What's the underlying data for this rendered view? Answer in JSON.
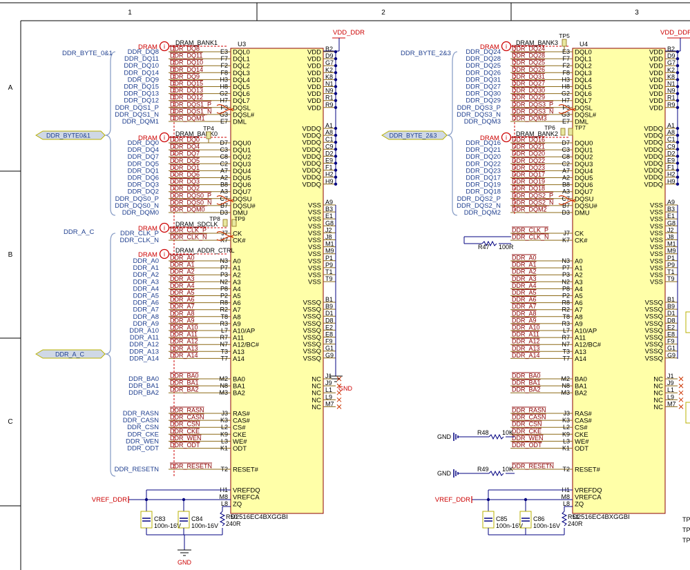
{
  "frame": {
    "columns": [
      "1",
      "2",
      "3"
    ],
    "rows": [
      "A",
      "B",
      "C"
    ]
  },
  "colors": {
    "wire": "#000080",
    "label": "#1f3f8f",
    "netlabel": "#8b0000",
    "body": "#ffffa8",
    "border": "#8b0000",
    "drawing": "#8b6914",
    "dram": "#cc0000",
    "tp": "#e8e8a0",
    "frame": "#000000"
  },
  "u3": {
    "ref": "U3",
    "part": "D2516EC4BXGGBI",
    "power_net": "VDD_DDR",
    "ground_net": "GND",
    "vref_net": "VREF_DDR",
    "groups": [
      {
        "dram": "DRAM",
        "bank": "DRAM_BANK1",
        "bus": "DDR_BYTE_0&1",
        "bus_label_text": "DDR_BYTE_0&1"
      },
      {
        "dram": "DRAM",
        "bank": "DRAM_BANK0"
      },
      {
        "dram": "DRAM",
        "bank": "DRAM_SDCLK",
        "bus": "DDR_A_C"
      },
      {
        "dram": "DRAM",
        "bank": "DRAM_ADDR_CTRL"
      }
    ],
    "bus_port_upper": "DDR_BYTE0&1",
    "bus_port_lower": "DDR_A_C",
    "testpoints": [
      "TP4",
      "TP8",
      "TP9"
    ],
    "caps": [
      {
        "ref": "C83",
        "val": "100n-16V"
      },
      {
        "ref": "C84",
        "val": "100n-16V"
      }
    ],
    "resistor": {
      "ref": "R50",
      "val": "240R"
    },
    "left_pins": [
      {
        "ext": "DDR_DQ8",
        "net": "DDR_DQ8",
        "num": "E3",
        "name": "DQL0"
      },
      {
        "ext": "DDR_DQ11",
        "net": "DDR_DQ11",
        "num": "F7",
        "name": "DQL1"
      },
      {
        "ext": "DDR_DQ10",
        "net": "DDR_DQ10",
        "num": "F2",
        "name": "DQL2"
      },
      {
        "ext": "DDR_DQ14",
        "net": "DDR_DQ14",
        "num": "F8",
        "name": "DQL3"
      },
      {
        "ext": "DDR_DQ9",
        "net": "DDR_DQ9",
        "num": "H3",
        "name": "DQL4"
      },
      {
        "ext": "DDR_DQ15",
        "net": "DDR_DQ15",
        "num": "H8",
        "name": "DQL5"
      },
      {
        "ext": "DDR_DQ13",
        "net": "DDR_DQ13",
        "num": "G2",
        "name": "DQL6"
      },
      {
        "ext": "DDR_DQ12",
        "net": "DDR_DQ12",
        "num": "H7",
        "name": "DQL7"
      },
      {
        "ext": "DDR_DQS1_P",
        "net": "DDR_DQS1_P",
        "num": "F3",
        "name": "DQSL"
      },
      {
        "ext": "DDR_DQS1_N",
        "net": "DDR_DQS1_N",
        "num": "G3",
        "name": "DQSL#"
      },
      {
        "ext": "DDR_DQM1",
        "net": "DDR_DQM1",
        "num": "E7",
        "name": "DML"
      },
      {
        "ext": "DDR_DQ0",
        "net": "DDR_DQ0",
        "num": "D7",
        "name": "DQU0"
      },
      {
        "ext": "DDR_DQ4",
        "net": "DDR_DQ4",
        "num": "C3",
        "name": "DQU1"
      },
      {
        "ext": "DDR_DQ7",
        "net": "DDR_DQ7",
        "num": "C8",
        "name": "DQU2"
      },
      {
        "ext": "DDR_DQ5",
        "net": "DDR_DQ5",
        "num": "C2",
        "name": "DQU3"
      },
      {
        "ext": "DDR_DQ1",
        "net": "DDR_DQ1",
        "num": "A7",
        "name": "DQU4"
      },
      {
        "ext": "DDR_DQ6",
        "net": "DDR_DQ6",
        "num": "A2",
        "name": "DQU5"
      },
      {
        "ext": "DDR_DQ3",
        "net": "DDR_DQ3",
        "num": "B8",
        "name": "DQU6"
      },
      {
        "ext": "DDR_DQ2",
        "net": "DDR_DQ2",
        "num": "A3",
        "name": "DQU7"
      },
      {
        "ext": "DDR_DQS0_P",
        "net": "DDR_DQS0_P",
        "num": "C7",
        "name": "DQSU"
      },
      {
        "ext": "DDR_DQS0_N",
        "net": "DDR_DQS0_N",
        "num": "B7",
        "name": "DQSU#"
      },
      {
        "ext": "DDR_DQM0",
        "net": "DDR_DQM0",
        "num": "D3",
        "name": "DMU"
      },
      {
        "ext": "DDR_CLK_P",
        "net": "DDR_CLK_P",
        "num": "J7",
        "name": "CK"
      },
      {
        "ext": "DDR_CLK_N",
        "net": "DDR_CLK_N",
        "num": "K7",
        "name": "CK#"
      },
      {
        "ext": "DDR_A0",
        "net": "DDR_A0",
        "num": "N3",
        "name": "A0"
      },
      {
        "ext": "DDR_A1",
        "net": "DDR_A1",
        "num": "P7",
        "name": "A1"
      },
      {
        "ext": "DDR_A2",
        "net": "DDR_A2",
        "num": "P3",
        "name": "A2"
      },
      {
        "ext": "DDR_A3",
        "net": "DDR_A3",
        "num": "N2",
        "name": "A3"
      },
      {
        "ext": "DDR_A4",
        "net": "DDR_A4",
        "num": "P8",
        "name": "A4"
      },
      {
        "ext": "DDR_A5",
        "net": "DDR_A5",
        "num": "P2",
        "name": "A5"
      },
      {
        "ext": "DDR_A6",
        "net": "DDR_A6",
        "num": "R8",
        "name": "A6"
      },
      {
        "ext": "DDR_A7",
        "net": "DDR_A7",
        "num": "R2",
        "name": "A7"
      },
      {
        "ext": "DDR_A8",
        "net": "DDR_A8",
        "num": "T8",
        "name": "A8"
      },
      {
        "ext": "DDR_A9",
        "net": "DDR_A9",
        "num": "R3",
        "name": "A9"
      },
      {
        "ext": "DDR_A10",
        "net": "DDR_A10",
        "num": "L7",
        "name": "A10/AP"
      },
      {
        "ext": "DDR_A11",
        "net": "DDR_A11",
        "num": "R7",
        "name": "A11"
      },
      {
        "ext": "DDR_A12",
        "net": "DDR_A12",
        "num": "N7",
        "name": "A12/BC#"
      },
      {
        "ext": "DDR_A13",
        "net": "DDR_A13",
        "num": "T3",
        "name": "A13"
      },
      {
        "ext": "DDR_A14",
        "net": "DDR_A14",
        "num": "T7",
        "name": "A14"
      },
      {
        "ext": "DDR_BA0",
        "net": "DDR_BA0",
        "num": "M2",
        "name": "BA0"
      },
      {
        "ext": "DDR_BA1",
        "net": "DDR_BA1",
        "num": "N8",
        "name": "BA1"
      },
      {
        "ext": "DDR_BA2",
        "net": "DDR_BA2",
        "num": "M3",
        "name": "BA2"
      },
      {
        "ext": "DDR_RASN",
        "net": "DDR_RASN",
        "num": "J3",
        "name": "RAS#"
      },
      {
        "ext": "DDR_CASN",
        "net": "DDR_CASN",
        "num": "K3",
        "name": "CAS#"
      },
      {
        "ext": "DDR_CSN",
        "net": "DDR_CSN",
        "num": "L2",
        "name": "CS#"
      },
      {
        "ext": "DDR_CKE",
        "net": "DDR_CKE",
        "num": "K9",
        "name": "CKE"
      },
      {
        "ext": "DDR_WEN",
        "net": "DDR_WEN",
        "num": "L3",
        "name": "WE#"
      },
      {
        "ext": "DDR_ODT",
        "net": "DDR_ODT",
        "num": "K1",
        "name": "ODT"
      },
      {
        "ext": "DDR_RESETN",
        "net": "DDR_RESETN",
        "num": "T2",
        "name": "RESET#"
      },
      {
        "ext": "",
        "net": "",
        "num": "H1",
        "name": "VREFDQ"
      },
      {
        "ext": "VREF_DDR",
        "net": "",
        "num": "M8",
        "name": "VREFCA"
      },
      {
        "ext": "",
        "net": "",
        "num": "L8",
        "name": "ZQ"
      }
    ]
  },
  "u4": {
    "ref": "U4",
    "part": "D2516EC4BXGGBI",
    "power_net": "VDD_DDR",
    "vref_net": "VREF_DDR",
    "gnd_label": "GND",
    "groups": [
      {
        "dram": "DRAM",
        "bank": "DRAM_BANK3",
        "bus": "DDR_BYTE_2&3"
      },
      {
        "dram": "DRAM",
        "bank": "DRAM_BANK2"
      }
    ],
    "bus_port_upper": "DDR_BYTE_2&3",
    "testpoints": [
      "TP5",
      "TP6",
      "TP7"
    ],
    "caps": [
      {
        "ref": "C85",
        "val": "100n-16V"
      },
      {
        "ref": "C86",
        "val": "100n-16V"
      }
    ],
    "resistor": {
      "ref": "R51",
      "val": "240R"
    },
    "clk_term": {
      "ref": "R47",
      "val": "100R"
    },
    "cke_pull": {
      "ref": "R48",
      "val": "10K"
    },
    "reset_pull": {
      "ref": "R49",
      "val": "10K"
    },
    "left_pins": [
      {
        "ext": "DDR_DQ24",
        "net": "DDR_DQ24",
        "num": "E3",
        "name": "DQL0"
      },
      {
        "ext": "DDR_DQ28",
        "net": "DDR_DQ28",
        "num": "F7",
        "name": "DQL1"
      },
      {
        "ext": "DDR_DQ25",
        "net": "DDR_DQ25",
        "num": "F2",
        "name": "DQL2"
      },
      {
        "ext": "DDR_DQ26",
        "net": "DDR_DQ26",
        "num": "F8",
        "name": "DQL3"
      },
      {
        "ext": "DDR_DQ31",
        "net": "DDR_DQ31",
        "num": "H3",
        "name": "DQL4"
      },
      {
        "ext": "DDR_DQ27",
        "net": "DDR_DQ27",
        "num": "H8",
        "name": "DQL5"
      },
      {
        "ext": "DDR_DQ30",
        "net": "DDR_DQ30",
        "num": "G2",
        "name": "DQL6"
      },
      {
        "ext": "DDR_DQ29",
        "net": "DDR_DQ29",
        "num": "H7",
        "name": "DQL7"
      },
      {
        "ext": "DDR_DQS3_P",
        "net": "DDR_DQS3_P",
        "num": "F3",
        "name": "DQSL"
      },
      {
        "ext": "DDR_DQS3_N",
        "net": "DDR_DQS3_N",
        "num": "G3",
        "name": "DQSL#"
      },
      {
        "ext": "DDR_DQM3",
        "net": "DDR_DQM3",
        "num": "E7",
        "name": "DML"
      },
      {
        "ext": "DDR_DQ16",
        "net": "DDR_DQ16",
        "num": "D7",
        "name": "DQU0"
      },
      {
        "ext": "DDR_DQ21",
        "net": "DDR_DQ21",
        "num": "C3",
        "name": "DQU1"
      },
      {
        "ext": "DDR_DQ20",
        "net": "DDR_DQ20",
        "num": "C8",
        "name": "DQU2"
      },
      {
        "ext": "DDR_DQ22",
        "net": "DDR_DQ22",
        "num": "C2",
        "name": "DQU3"
      },
      {
        "ext": "DDR_DQ23",
        "net": "DDR_DQ23",
        "num": "A7",
        "name": "DQU4"
      },
      {
        "ext": "DDR_DQ17",
        "net": "DDR_DQ17",
        "num": "A2",
        "name": "DQU5"
      },
      {
        "ext": "DDR_DQ19",
        "net": "DDR_DQ19",
        "num": "B8",
        "name": "DQU6"
      },
      {
        "ext": "DDR_DQ18",
        "net": "DDR_DQ18",
        "num": "A3",
        "name": "DQU7"
      },
      {
        "ext": "DDR_DQS2_P",
        "net": "DDR_DQS2_P",
        "num": "C7",
        "name": "DQSU"
      },
      {
        "ext": "DDR_DQS2_N",
        "net": "DDR_DQS2_N",
        "num": "B7",
        "name": "DQSU#"
      },
      {
        "ext": "DDR_DQM2",
        "net": "DDR_DQM2",
        "num": "D3",
        "name": "DMU"
      },
      {
        "ext": "",
        "net": "DDR_CLK_P",
        "num": "J7",
        "name": "CK"
      },
      {
        "ext": "",
        "net": "DDR_CLK_N",
        "num": "K7",
        "name": "CK#"
      },
      {
        "ext": "",
        "net": "DDR_A0",
        "num": "N3",
        "name": "A0"
      },
      {
        "ext": "",
        "net": "DDR_A1",
        "num": "P7",
        "name": "A1"
      },
      {
        "ext": "",
        "net": "DDR_A2",
        "num": "P3",
        "name": "A2"
      },
      {
        "ext": "",
        "net": "DDR_A3",
        "num": "N2",
        "name": "A3"
      },
      {
        "ext": "",
        "net": "DDR_A4",
        "num": "P8",
        "name": "A4"
      },
      {
        "ext": "",
        "net": "DDR_A5",
        "num": "P2",
        "name": "A5"
      },
      {
        "ext": "",
        "net": "DDR_A6",
        "num": "R8",
        "name": "A6"
      },
      {
        "ext": "",
        "net": "DDR_A7",
        "num": "R2",
        "name": "A7"
      },
      {
        "ext": "",
        "net": "DDR_A8",
        "num": "T8",
        "name": "A8"
      },
      {
        "ext": "",
        "net": "DDR_A9",
        "num": "R3",
        "name": "A9"
      },
      {
        "ext": "",
        "net": "DDR_A10",
        "num": "L7",
        "name": "A10/AP"
      },
      {
        "ext": "",
        "net": "DDR_A11",
        "num": "R7",
        "name": "A11"
      },
      {
        "ext": "",
        "net": "DDR_A12",
        "num": "N7",
        "name": "A12/BC#"
      },
      {
        "ext": "",
        "net": "DDR_A13",
        "num": "T3",
        "name": "A13"
      },
      {
        "ext": "",
        "net": "DDR_A14",
        "num": "T7",
        "name": "A14"
      },
      {
        "ext": "",
        "net": "DDR_BA0",
        "num": "M2",
        "name": "BA0"
      },
      {
        "ext": "",
        "net": "DDR_BA1",
        "num": "N8",
        "name": "BA1"
      },
      {
        "ext": "",
        "net": "DDR_BA2",
        "num": "M3",
        "name": "BA2"
      },
      {
        "ext": "",
        "net": "DDR_RASN",
        "num": "J3",
        "name": "RAS#"
      },
      {
        "ext": "",
        "net": "DDR_CASN",
        "num": "K3",
        "name": "CAS#"
      },
      {
        "ext": "",
        "net": "DDR_CSN",
        "num": "L2",
        "name": "CS#"
      },
      {
        "ext": "",
        "net": "DDR_CKE",
        "num": "K9",
        "name": "CKE"
      },
      {
        "ext": "",
        "net": "DDR_WEN",
        "num": "L3",
        "name": "WE#"
      },
      {
        "ext": "",
        "net": "DDR_ODT",
        "num": "K1",
        "name": "ODT"
      },
      {
        "ext": "",
        "net": "DDR_RESETN",
        "num": "T2",
        "name": "RESET#"
      },
      {
        "ext": "",
        "net": "",
        "num": "H1",
        "name": "VREFDQ"
      },
      {
        "ext": "VREF_DDR",
        "net": "",
        "num": "M8",
        "name": "VREFCA"
      },
      {
        "ext": "",
        "net": "",
        "num": "L8",
        "name": "ZQ"
      }
    ]
  },
  "right_pins": [
    {
      "num": "B2",
      "name": "VDD"
    },
    {
      "num": "D9",
      "name": "VDD"
    },
    {
      "num": "G7",
      "name": "VDD"
    },
    {
      "num": "K2",
      "name": "VDD"
    },
    {
      "num": "K8",
      "name": "VDD"
    },
    {
      "num": "N1",
      "name": "VDD"
    },
    {
      "num": "N9",
      "name": "VDD"
    },
    {
      "num": "R1",
      "name": "VDD"
    },
    {
      "num": "R9",
      "name": "VDD"
    },
    {
      "num": "A1",
      "name": "VDDQ"
    },
    {
      "num": "A8",
      "name": "VDDQ"
    },
    {
      "num": "C1",
      "name": "VDDQ"
    },
    {
      "num": "C9",
      "name": "VDDQ"
    },
    {
      "num": "D2",
      "name": "VDDQ"
    },
    {
      "num": "E9",
      "name": "VDDQ"
    },
    {
      "num": "F1",
      "name": "VDDQ"
    },
    {
      "num": "H2",
      "name": "VDDQ"
    },
    {
      "num": "H9",
      "name": "VDDQ"
    },
    {
      "num": "A9",
      "name": "VSS"
    },
    {
      "num": "B3",
      "name": "VSS"
    },
    {
      "num": "E1",
      "name": "VSS"
    },
    {
      "num": "G8",
      "name": "VSS"
    },
    {
      "num": "J2",
      "name": "VSS"
    },
    {
      "num": "J8",
      "name": "VSS"
    },
    {
      "num": "M1",
      "name": "VSS"
    },
    {
      "num": "M9",
      "name": "VSS"
    },
    {
      "num": "P1",
      "name": "VSS"
    },
    {
      "num": "P9",
      "name": "VSS"
    },
    {
      "num": "T1",
      "name": "VSS"
    },
    {
      "num": "T9",
      "name": "VSS"
    },
    {
      "num": "B1",
      "name": "VSSQ"
    },
    {
      "num": "B9",
      "name": "VSSQ"
    },
    {
      "num": "D1",
      "name": "VSSQ"
    },
    {
      "num": "D8",
      "name": "VSSQ"
    },
    {
      "num": "E2",
      "name": "VSSQ"
    },
    {
      "num": "E8",
      "name": "VSSQ"
    },
    {
      "num": "F9",
      "name": "VSSQ"
    },
    {
      "num": "G1",
      "name": "VSSQ"
    },
    {
      "num": "G9",
      "name": "VSSQ"
    },
    {
      "num": "J1",
      "name": "NC"
    },
    {
      "num": "J9",
      "name": "NC"
    },
    {
      "num": "L1",
      "name": "NC"
    },
    {
      "num": "L9",
      "name": "NC"
    },
    {
      "num": "M7",
      "name": "NC"
    }
  ],
  "tp_right_edge": [
    "TP",
    "TP",
    "TP"
  ]
}
